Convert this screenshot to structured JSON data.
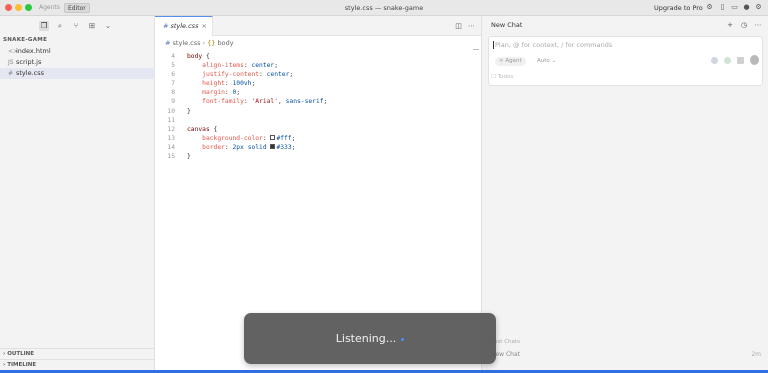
{
  "titlebar": {
    "title": "style.css — snake-game",
    "modes": [
      "Agents",
      "Editor"
    ],
    "upgrade_label": "Upgrade to Pro"
  },
  "sidebar": {
    "folder": "SNAKE-GAME",
    "files": [
      {
        "name": "index.html",
        "selected": false
      },
      {
        "name": "script.js",
        "selected": false
      },
      {
        "name": "style.css",
        "selected": true
      }
    ],
    "sections": [
      "OUTLINE",
      "TIMELINE"
    ]
  },
  "editor": {
    "tab": {
      "name": "style.css"
    },
    "breadcrumb": [
      "style.css",
      "body"
    ],
    "lines": [
      "4",
      "5",
      "6",
      "7",
      "8",
      "9",
      "10",
      "11",
      "12",
      "13",
      "14",
      "15"
    ]
  },
  "chat": {
    "title": "New Chat",
    "placeholder": "Plan, @ for context, / for commands",
    "mode": "Agent",
    "model": "Auto",
    "todo": "Todos",
    "past_chats": "Past Chats",
    "recent": {
      "title": "New Chat",
      "age": "2m"
    }
  },
  "overlay": {
    "text": "Listening..."
  }
}
